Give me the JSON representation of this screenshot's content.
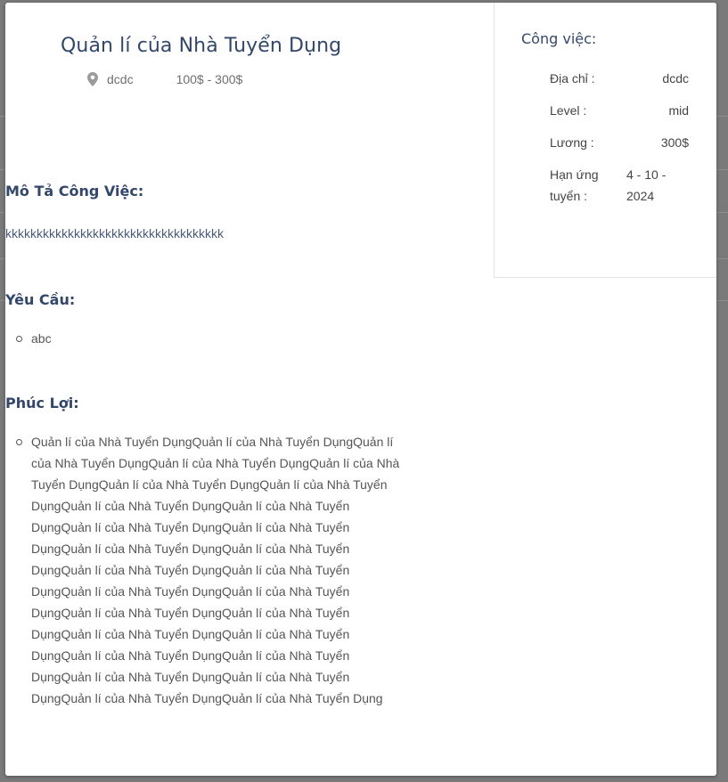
{
  "job": {
    "title": "Quản lí của Nhà Tuyển Dụng",
    "location": "dcdc",
    "salary_range": "100$ - 300$"
  },
  "description": {
    "heading": "Mô Tả Công Việc:",
    "text": "kkkkkkkkkkkkkkkkkkkkkkkkkkkkkkkkkkk"
  },
  "requirements": {
    "heading": "Yêu Cầu:",
    "items": [
      "abc"
    ]
  },
  "benefits": {
    "heading": "Phúc Lợi:",
    "items": [
      "Quản lí của Nhà Tuyển DụngQuản lí của Nhà Tuyển DụngQuản lí của Nhà Tuyển DụngQuản lí của Nhà Tuyển DụngQuản lí của Nhà Tuyển DụngQuản lí của Nhà Tuyển DụngQuản lí của Nhà Tuyển DụngQuản lí của Nhà Tuyển DụngQuản lí của Nhà Tuyển DụngQuản lí của Nhà Tuyển DụngQuản lí của Nhà Tuyển DụngQuản lí của Nhà Tuyển DụngQuản lí của Nhà Tuyển DụngQuản lí của Nhà Tuyển DụngQuản lí của Nhà Tuyển DụngQuản lí của Nhà Tuyển DụngQuản lí của Nhà Tuyển DụngQuản lí của Nhà Tuyển DụngQuản lí của Nhà Tuyển DụngQuản lí của Nhà Tuyển DụngQuản lí của Nhà Tuyển DụngQuản lí của Nhà Tuyển DụngQuản lí của Nhà Tuyển DụngQuản lí của Nhà Tuyển DụngQuản lí của Nhà Tuyển DụngQuản lí của Nhà Tuyển DụngQuản lí của Nhà Tuyển Dụng"
    ]
  },
  "side_card": {
    "title": "Công việc:",
    "address_label": "Địa chỉ :",
    "address_value": "dcdc",
    "level_label": "Level :",
    "level_value": "mid",
    "salary_label": "Lương :",
    "salary_value": "300$",
    "deadline_label": "Hạn ứng tuyển :",
    "deadline_value": "4 - 10 - 2024"
  },
  "icons": {
    "location": "map-pin-icon"
  },
  "colors": {
    "heading": "#33476b",
    "overlay": "#6b6b6b",
    "modal": "#ffffff"
  }
}
